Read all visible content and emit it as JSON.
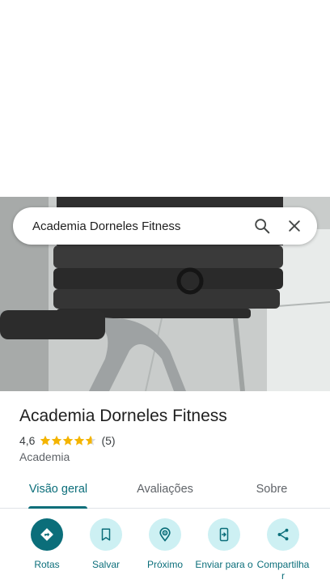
{
  "search": {
    "query": "Academia Dorneles Fitness"
  },
  "place": {
    "name": "Academia Dorneles Fitness",
    "rating": "4,6",
    "rating_value": 4.6,
    "review_count": "(5)",
    "category": "Academia"
  },
  "tabs": [
    {
      "label": "Visão geral",
      "active": true
    },
    {
      "label": "Avaliações",
      "active": false
    },
    {
      "label": "Sobre",
      "active": false
    }
  ],
  "actions": [
    {
      "label": "Rotas",
      "icon": "directions-icon"
    },
    {
      "label": "Salvar",
      "icon": "bookmark-icon"
    },
    {
      "label": "Próximo",
      "icon": "nearby-icon"
    },
    {
      "label": "Enviar para o",
      "icon": "send-to-phone-icon"
    },
    {
      "label": "Compartilha r",
      "icon": "share-icon"
    }
  ],
  "colors": {
    "accent": "#0b6e7a",
    "action_bg": "#cdf0f3",
    "star": "#f4b400"
  }
}
